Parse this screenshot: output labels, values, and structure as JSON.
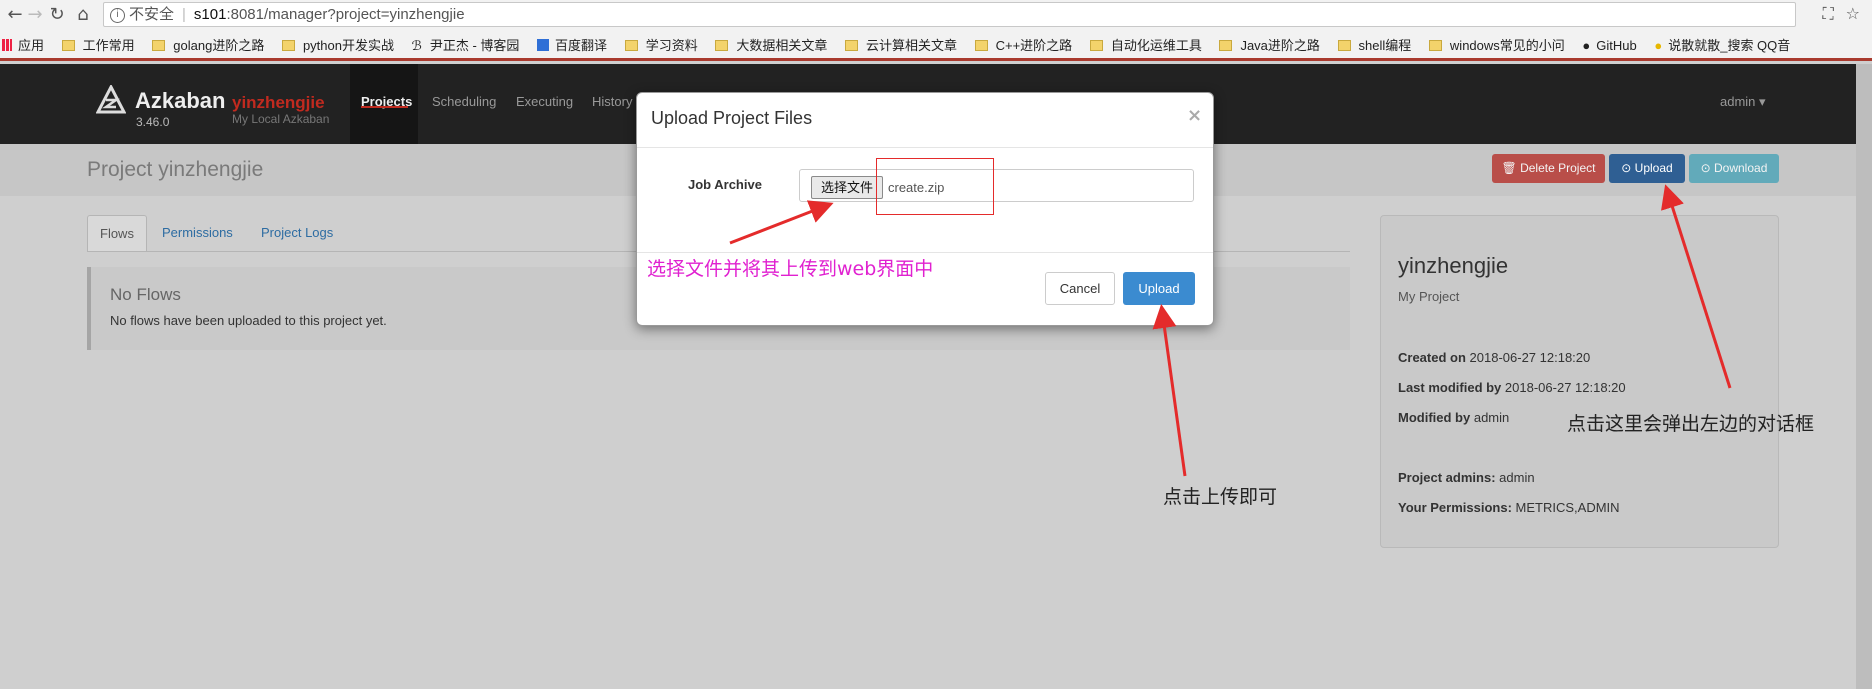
{
  "browser": {
    "nav_back": "←",
    "nav_forward": "→",
    "nav_reload": "↻",
    "nav_home": "⌂",
    "security_label": "不安全",
    "url_host": "s101",
    "url_rest": ":8081/manager?project=yinzhengjie",
    "icons": [
      "translate-icon",
      "star-icon"
    ]
  },
  "bookmarks": {
    "apps_label": "应用",
    "items": [
      "工作常用",
      "golang进阶之路",
      "python开发实战",
      "尹正杰 - 博客园",
      "百度翻译",
      "学习资料",
      "大数据相关文章",
      "云计算相关文章",
      "C++进阶之路",
      "自动化运维工具",
      "Java进阶之路",
      "shell编程",
      "windows常见的小问",
      "GitHub",
      "说散就散_搜索 QQ音"
    ]
  },
  "app": {
    "brand": "Azkaban",
    "project_name": "yinzhengjie",
    "version": "3.46.0",
    "subtitle": "My Local Azkaban",
    "nav": [
      "Projects",
      "Scheduling",
      "Executing",
      "History"
    ],
    "admin": "admin ▾"
  },
  "page": {
    "title": "Project yinzhengjie",
    "delete_button": "Delete Project",
    "upload_button": "Upload",
    "download_button": "Download",
    "tabs": [
      "Flows",
      "Permissions",
      "Project Logs"
    ],
    "flows_title": "No Flows",
    "flows_text": "No flows have been uploaded to this project yet."
  },
  "info": {
    "name": "yinzhengjie",
    "description": "My Project",
    "created_label": "Created on",
    "created_value": "2018-06-27 12:18:20",
    "modified_label": "Last modified by",
    "modified_value": "2018-06-27 12:18:20",
    "modified_by_label": "Modified by",
    "modified_by_value": "admin",
    "admins_label": "Project admins:",
    "admins_value": "admin",
    "permissions_label": "Your Permissions:",
    "permissions_value": "METRICS,ADMIN"
  },
  "modal": {
    "title": "Upload Project Files",
    "close": "×",
    "job_label": "Job Archive",
    "choose_file": "选择文件",
    "file_name": "create.zip",
    "cancel": "Cancel",
    "upload": "Upload"
  },
  "annotations": {
    "pink": "选择文件并将其上传到web界面中",
    "upload_hint": "点击上传即可",
    "dialog_hint": "点击这里会弹出左边的对话框",
    "color_pink": "#e021d0",
    "color_red": "#e42b2b"
  }
}
